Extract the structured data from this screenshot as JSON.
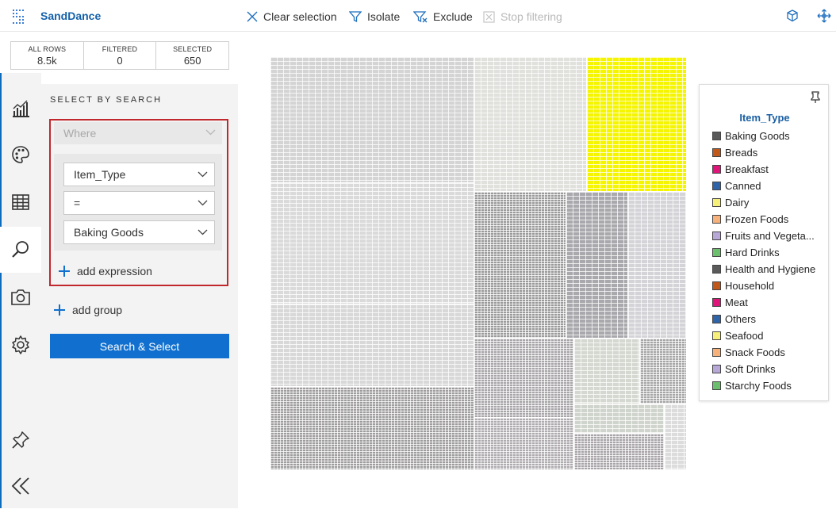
{
  "app": {
    "name": "SandDance"
  },
  "toolbar": {
    "clear_selection": "Clear selection",
    "isolate": "Isolate",
    "exclude": "Exclude",
    "stop_filtering": "Stop filtering"
  },
  "stats": [
    {
      "label": "ALL ROWS",
      "value": "8.5k"
    },
    {
      "label": "FILTERED",
      "value": "0"
    },
    {
      "label": "SELECTED",
      "value": "650"
    }
  ],
  "search_panel": {
    "title": "SELECT BY SEARCH",
    "where_placeholder": "Where",
    "field_value": "Item_Type",
    "operator_value": "=",
    "compare_value": "Baking Goods",
    "add_expression": "add expression",
    "add_group": "add group",
    "submit_label": "Search & Select"
  },
  "legend": {
    "title": "Item_Type",
    "items": [
      {
        "label": "Baking Goods",
        "color": "#5a5a5a"
      },
      {
        "label": "Breads",
        "color": "#c0581a"
      },
      {
        "label": "Breakfast",
        "color": "#e0157a"
      },
      {
        "label": "Canned",
        "color": "#3064a8"
      },
      {
        "label": "Dairy",
        "color": "#f6f07a"
      },
      {
        "label": "Frozen Foods",
        "color": "#f6b27a"
      },
      {
        "label": "Fruits and Vegeta...",
        "color": "#b8a8d8"
      },
      {
        "label": "Hard Drinks",
        "color": "#6cbf6c"
      },
      {
        "label": "Health and Hygiene",
        "color": "#5a5a5a"
      },
      {
        "label": "Household",
        "color": "#c0581a"
      },
      {
        "label": "Meat",
        "color": "#e0157a"
      },
      {
        "label": "Others",
        "color": "#3064a8"
      },
      {
        "label": "Seafood",
        "color": "#f6f07a"
      },
      {
        "label": "Snack Foods",
        "color": "#f6b27a"
      },
      {
        "label": "Soft Drinks",
        "color": "#b8a8d8"
      },
      {
        "label": "Starchy Foods",
        "color": "#6cbf6c"
      }
    ]
  },
  "icons": {
    "rail": [
      "chart-icon",
      "palette-icon",
      "table-icon",
      "search-icon",
      "camera-icon",
      "settings-icon",
      "pin-icon",
      "collapse-icon"
    ]
  }
}
